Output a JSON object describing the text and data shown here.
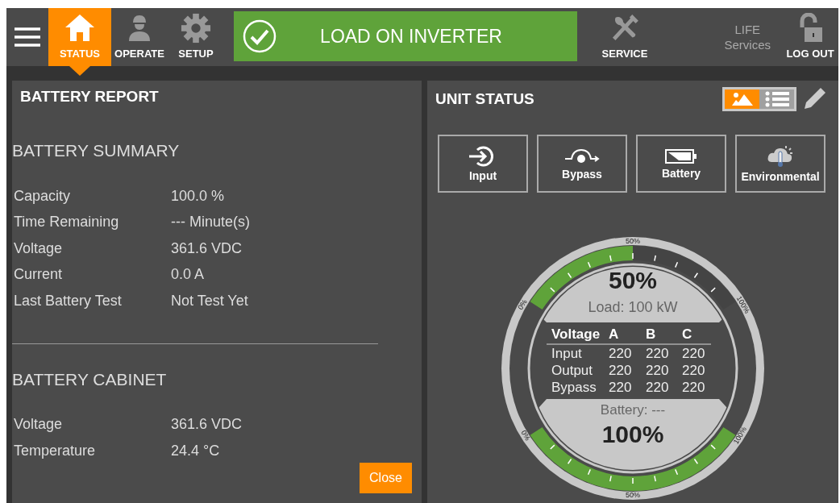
{
  "nav": [
    {
      "label": "STATUS",
      "selected": true
    },
    {
      "label": "OPERATE",
      "selected": false
    },
    {
      "label": "SETUP",
      "selected": false
    }
  ],
  "banner": {
    "text": "LOAD ON INVERTER"
  },
  "service": {
    "label": "SERVICE"
  },
  "life": {
    "lines": [
      "LIFE",
      "Services"
    ]
  },
  "logout": {
    "label": "LOG OUT"
  },
  "battery_report": {
    "title": "BATTERY REPORT",
    "sections": [
      {
        "heading": "BATTERY SUMMARY",
        "rows": [
          {
            "label": "Capacity",
            "value": "100.0 %"
          },
          {
            "label": "Time Remaining",
            "value": "--- Minute(s)"
          },
          {
            "label": "Voltage",
            "value": "361.6 VDC"
          },
          {
            "label": "Current",
            "value": "0.0 A"
          },
          {
            "label": "Last Battery Test",
            "value": "Not Test Yet"
          }
        ]
      },
      {
        "heading": "BATTERY CABINET",
        "rows": [
          {
            "label": "Voltage",
            "value": "361.6 VDC"
          },
          {
            "label": "Temperature",
            "value": "24.4 °C"
          }
        ]
      }
    ],
    "close": "Close"
  },
  "unit_status": {
    "title": "UNIT STATUS",
    "view_toggle": [
      {
        "selected": true
      },
      {
        "selected": false
      }
    ],
    "tiles": [
      "Input",
      "Bypass",
      "Battery",
      "Environmental"
    ],
    "load_gauge": {
      "value": "50%",
      "caption": "Load: 100 kW",
      "level": 0.5,
      "scale": [
        "0%",
        "50%",
        "100%"
      ]
    },
    "voltage_table": {
      "columns": [
        "Voltage",
        "A",
        "B",
        "C"
      ],
      "rows": [
        {
          "label": "Input",
          "values": [
            "220",
            "220",
            "220"
          ]
        },
        {
          "label": "Output",
          "values": [
            "220",
            "220",
            "220"
          ]
        },
        {
          "label": "Bypass",
          "values": [
            "220",
            "220",
            "220"
          ]
        }
      ]
    },
    "battery_gauge": {
      "value": "100%",
      "caption": "Battery: ---",
      "level": 1,
      "scale": [
        "0%",
        "50%",
        "100%"
      ]
    }
  }
}
